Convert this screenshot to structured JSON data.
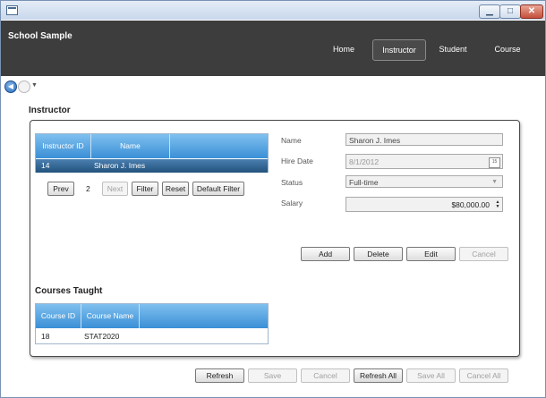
{
  "window": {
    "min_symbol": "▁",
    "max_symbol": "□",
    "close_symbol": "✕"
  },
  "header": {
    "title": "School Sample",
    "nav": [
      {
        "label": "Home",
        "selected": false
      },
      {
        "label": "Instructor",
        "selected": true
      },
      {
        "label": "Student",
        "selected": false
      },
      {
        "label": "Course",
        "selected": false
      }
    ]
  },
  "instructor": {
    "title": "Instructor",
    "grid": {
      "columns": [
        "Instructor ID",
        "Name"
      ],
      "rows": [
        {
          "id": "14",
          "name": "Sharon J. Imes",
          "selected": true
        }
      ]
    },
    "pager": {
      "prev": "Prev",
      "page": "2",
      "next": "Next",
      "filter": "Filter",
      "reset": "Reset",
      "default_filter": "Default Filter"
    },
    "details": {
      "name_label": "Name",
      "name_value": "Sharon J. Imes",
      "hire_date_label": "Hire Date",
      "hire_date_value": "8/1/2012",
      "hire_date_icon_text": "15",
      "status_label": "Status",
      "status_value": "Full-time",
      "salary_label": "Salary",
      "salary_value": "$80,000.00"
    },
    "actions": {
      "add": "Add",
      "delete": "Delete",
      "edit": "Edit",
      "cancel": "Cancel"
    },
    "courses": {
      "title": "Courses Taught",
      "columns": [
        "Course ID",
        "Course Name"
      ],
      "rows": [
        {
          "id": "18",
          "name": "STAT2020"
        }
      ]
    }
  },
  "footer": {
    "refresh": "Refresh",
    "save": "Save",
    "cancel": "Cancel",
    "refresh_all": "Refresh All",
    "save_all": "Save All",
    "cancel_all": "Cancel All"
  },
  "colors": {
    "header_bg": "#3d3d3d",
    "grid_header": "#3a8fd6",
    "selected_row": "#23527d"
  }
}
